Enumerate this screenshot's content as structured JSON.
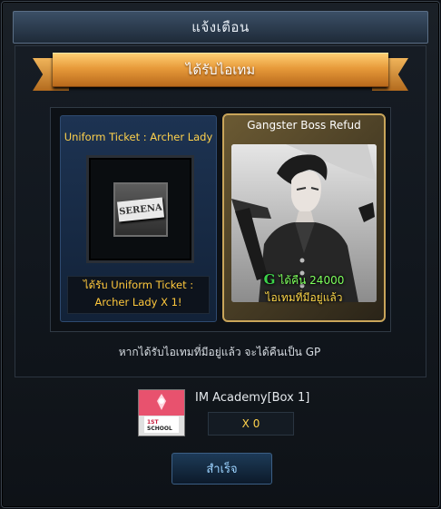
{
  "dialog": {
    "title": "แจ้งเตือน",
    "banner": "ได้รับไอเทม"
  },
  "received_item": {
    "name": "Uniform Ticket : Archer Lady",
    "thumbnail_text": "SERENA",
    "description": "ได้รับ Uniform Ticket : Archer Lady X 1!"
  },
  "owned_item": {
    "name": "Gangster Boss Refud",
    "refund_icon": "G",
    "refund_text": "ได้คืน 24000",
    "owned_text": "ไอเทมที่มีอยู่แล้ว"
  },
  "notice": "หากได้รับไอเทมที่มีอยู่แล้ว จะได้คืนเป็น GP",
  "box": {
    "name": "IM Academy[Box 1]",
    "quantity": "X 0",
    "icon_text_1": "1ST",
    "icon_text_2": "SCHOOL"
  },
  "buttons": {
    "ok": "สำเร็จ"
  },
  "colors": {
    "accent_gold": "#ffd24c",
    "banner_orange": "#e79a3a",
    "refund_green": "#7dff5c",
    "button_text": "#9cd3ff"
  }
}
